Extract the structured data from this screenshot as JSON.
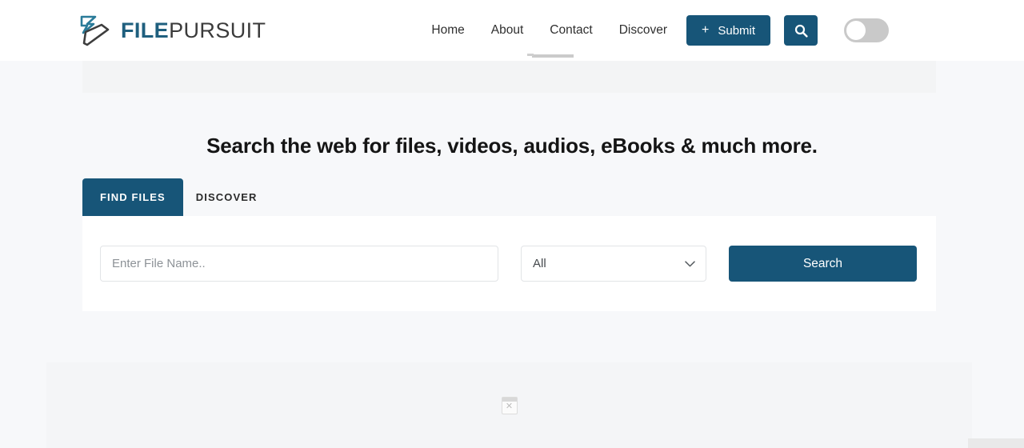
{
  "theme": {
    "accent": "#175578",
    "page_background": "#f7f8fa",
    "header_background": "#ffffff",
    "card_background": "#ffffff",
    "ad_background": "#f3f4f5",
    "brand_blue": "#1f5f7e",
    "brand_dark": "#3b3b3b"
  },
  "header": {
    "logo": {
      "icon": "double-arrow-logo-icon",
      "text_primary": "FILE",
      "text_secondary": "PURSUIT"
    },
    "nav": [
      {
        "label": "Home"
      },
      {
        "label": "About"
      },
      {
        "label": "Contact"
      },
      {
        "label": "Discover"
      }
    ],
    "submit_button": {
      "icon": "plus-icon",
      "plus": "+",
      "label": "Submit"
    },
    "search_icon_button": {
      "icon": "search-icon"
    },
    "theme_toggle": {
      "icon": "toggle-switch-icon",
      "state": "off"
    }
  },
  "hero": {
    "title": "Search the web for files, videos, audios, eBooks & much more."
  },
  "search": {
    "tabs": [
      {
        "label": "FIND FILES",
        "active": true
      },
      {
        "label": "DISCOVER",
        "active": false
      }
    ],
    "file_input": {
      "placeholder": "Enter File Name..",
      "value": ""
    },
    "type_select": {
      "selected": "All",
      "options": [
        "All"
      ],
      "chevron": "chevron-down-icon"
    },
    "search_button": {
      "label": "Search"
    }
  },
  "ads": {
    "top_slot": {
      "label": ""
    },
    "bottom_slot": {
      "placeholder_icon": "broken-image-icon",
      "placeholder_glyph": "✕"
    }
  }
}
